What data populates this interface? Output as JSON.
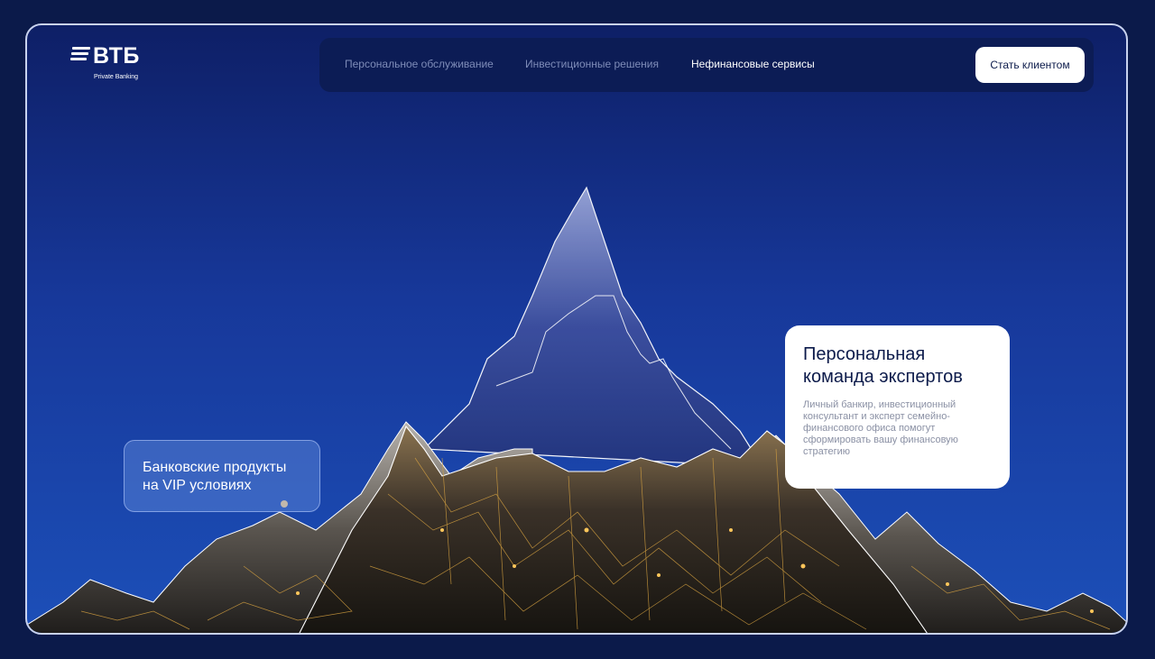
{
  "logo": {
    "name": "ВТБ",
    "sub": "Private Banking"
  },
  "nav": {
    "items": [
      {
        "label": "Персональное обслуживание"
      },
      {
        "label": "Инвестиционные решения"
      },
      {
        "label": "Нефинансовые сервисы"
      }
    ],
    "cta_label": "Стать клиентом"
  },
  "card_left": {
    "lines": [
      "Банковские продукты",
      "на VIP условиях"
    ]
  },
  "card_right": {
    "title_lines": [
      "Персональная",
      "команда экспертов"
    ],
    "text_lines": [
      "Личный банкир, инвестиционный",
      "консультант и эксперт семейно-",
      "финансового офиса помогут",
      "сформировать вашу финансовую",
      "стратегию"
    ]
  },
  "colors": {
    "background": "#0b1a4a",
    "accent": "#1c4fb8",
    "gold": "#d9a441"
  }
}
